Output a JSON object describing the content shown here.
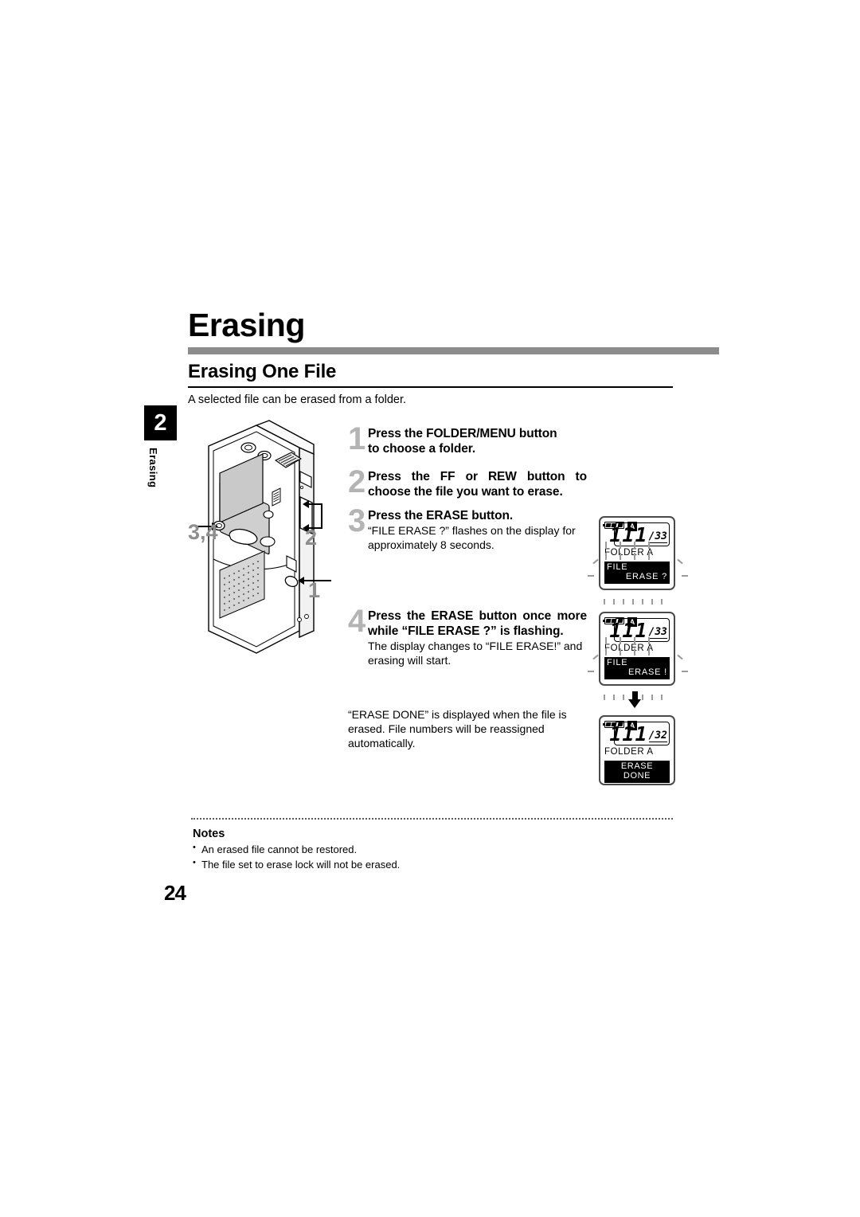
{
  "page": {
    "title": "Erasing",
    "section_title": "Erasing One File",
    "intro": "A selected file can be erased from a folder.",
    "number": "24"
  },
  "chapter_tab": {
    "number": "2",
    "label": "Erasing"
  },
  "device_figure": {
    "callouts": [
      {
        "id": "erase-button",
        "label": "3,4"
      },
      {
        "id": "ff-rew-buttons",
        "label": "2"
      },
      {
        "id": "folder-menu-button",
        "label": "1"
      }
    ]
  },
  "steps": [
    {
      "number": "1",
      "head_parts": [
        "Press the ",
        "FOLDER/MENU",
        " button to choose a folder."
      ],
      "head_plain": "Press the FOLDER/MENU button to choose a folder.",
      "sub": ""
    },
    {
      "number": "2",
      "head_plain": "Press the FF or REW button to choose the file you want to erase.",
      "sub": ""
    },
    {
      "number": "3",
      "head_plain": "Press the ERASE button.",
      "sub": "“FILE ERASE ?” flashes on the display for approximately 8 seconds."
    },
    {
      "number": "4",
      "head_plain": "Press the ERASE button once more while “FILE ERASE ?” is flashing.",
      "sub": "The display changes to “FILE ERASE!” and erasing will start."
    }
  ],
  "step_labels": {
    "s1_a": "Press the ",
    "s1_b": "FOLDER/MENU",
    "s1_c": " button",
    "s1_d": "to choose a folder.",
    "s2_a": "Press the ",
    "s2_b": "FF",
    "s2_c": " or ",
    "s2_d": "REW",
    "s2_e": " button to choose the file you want to erase.",
    "s3_a": "Press the ",
    "s3_b": "ERASE",
    "s3_c": " button.",
    "s3_sub": "“FILE ERASE ?” flashes on the display for approximately 8 seconds.",
    "s4_a": "Press the ",
    "s4_b": "ERASE",
    "s4_c": " button once more while “FILE ERASE ?” is flashing.",
    "s4_sub": "The display changes to “FILE ERASE!” and erasing will start."
  },
  "closing_text": "“ERASE DONE” is displayed when the file is erased. File numbers will be reassigned automatically.",
  "lcd_displays": [
    {
      "id": "lcd-file-erase-question",
      "battery_icon": "battery-icon",
      "folder_badge": "A",
      "file_number": "111",
      "total": "/33",
      "folder_label": "FOLDER  A",
      "status_line1": "FILE",
      "status_line2": "ERASE ?",
      "flashing": true
    },
    {
      "id": "lcd-file-erase-exclaim",
      "battery_icon": "battery-icon",
      "folder_badge": "A",
      "file_number": "111",
      "total": "/33",
      "folder_label": "FOLDER  A",
      "status_line1": "FILE",
      "status_line2": "ERASE !",
      "flashing": true
    },
    {
      "id": "lcd-erase-done",
      "battery_icon": "battery-icon",
      "folder_badge": "A",
      "file_number": "111",
      "total": "/32",
      "folder_label": "FOLDER  A",
      "status_single": "ERASE DONE",
      "flashing": false
    }
  ],
  "notes": {
    "title": "Notes",
    "items": [
      "An erased file cannot be restored.",
      "The file set to erase lock will not be erased."
    ]
  },
  "colors": {
    "title_bar": "#8c8c8c",
    "step_number": "#b4b4b4",
    "callout": "#8e8e8e",
    "lcd_border": "#4a4a4a"
  }
}
